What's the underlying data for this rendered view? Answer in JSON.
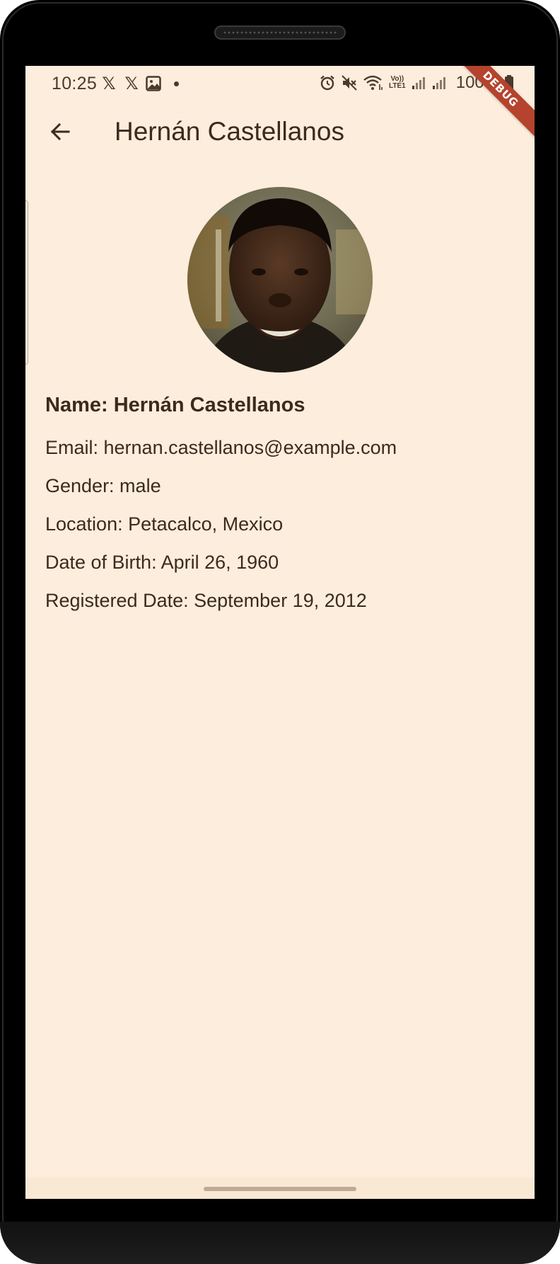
{
  "status_bar": {
    "time": "10:25",
    "battery": "100%",
    "left_icons": [
      "x-logo-icon",
      "x-logo-icon",
      "image-icon",
      "dot-icon"
    ],
    "right_icons": [
      "alarm-icon",
      "mute-icon",
      "wifi-icon",
      "volte-icon",
      "signal-icon",
      "signal-icon",
      "battery-icon"
    ],
    "volte_label_top": "Vo))",
    "volte_label_bottom": "LTE1",
    "x_glyph": "𝕏"
  },
  "debug_banner": "DEBUG",
  "app_bar": {
    "title": "Hernán Castellanos",
    "back_icon": "arrow-back-icon"
  },
  "profile": {
    "name_line": "Name: Hernán Castellanos",
    "email_line": "Email: hernan.castellanos@example.com",
    "gender_line": "Gender: male",
    "location_line": "Location: Petacalco, Mexico",
    "dob_line": "Date of Birth: April 26, 1960",
    "registered_line": "Registered Date: September 19, 2012"
  },
  "colors": {
    "background": "#fdeddc",
    "text": "#3b2a1e",
    "debug_ribbon": "#b5432d"
  }
}
